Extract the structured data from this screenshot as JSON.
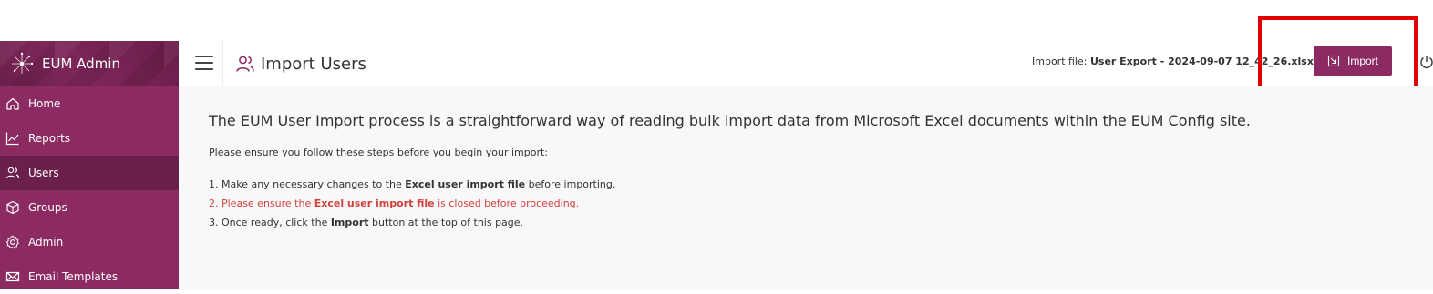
{
  "app": {
    "name": "EUM Admin"
  },
  "sidebar": {
    "items": [
      {
        "label": "Home",
        "icon": "home-icon",
        "active": false
      },
      {
        "label": "Reports",
        "icon": "chart-line-icon",
        "active": false
      },
      {
        "label": "Users",
        "icon": "users-icon",
        "active": true
      },
      {
        "label": "Groups",
        "icon": "cube-icon",
        "active": false
      },
      {
        "label": "Admin",
        "icon": "gear-icon",
        "active": false
      },
      {
        "label": "Email Templates",
        "icon": "envelope-icon",
        "active": false
      }
    ]
  },
  "header": {
    "title": "Import Users",
    "import_file_label": "Import file:",
    "import_file_name": "User Export - 2024-09-07 12_42_26.xlsx",
    "import_button_label": "Import"
  },
  "main": {
    "intro": "The EUM User Import process is a straightforward way of reading bulk import data from Microsoft Excel documents within the EUM Config site.",
    "ensure": "Please ensure you follow these steps before you begin your import:",
    "steps": [
      {
        "pre": "1. Make any necessary changes to the ",
        "bold": "Excel user import file",
        "post": " before importing."
      },
      {
        "pre": "2. Please ensure the ",
        "bold": "Excel user import file",
        "post": " is closed before proceeding."
      },
      {
        "pre": "3. Once ready, click the ",
        "bold": "Import",
        "post": " button at the top of this page."
      }
    ]
  },
  "colors": {
    "brand": "#8c2a62",
    "brand_dark": "#6b1f4b",
    "warning_text": "#d0423a",
    "highlight": "#e00000"
  }
}
